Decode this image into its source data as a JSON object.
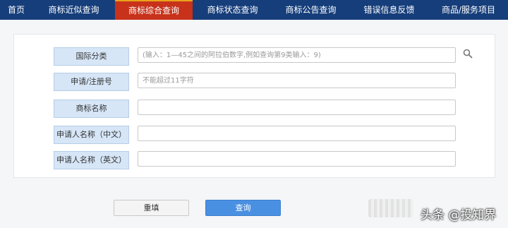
{
  "nav": {
    "items": [
      {
        "label": "首页"
      },
      {
        "label": "商标近似查询"
      },
      {
        "label": "商标综合查询"
      },
      {
        "label": "商标状态查询"
      },
      {
        "label": "商标公告查询"
      },
      {
        "label": "错误信息反馈"
      },
      {
        "label": "商品/服务项目"
      }
    ],
    "active_label": "商标综合查询"
  },
  "form": {
    "fields": [
      {
        "label": "国际分类",
        "value": "",
        "placeholder": "(输入：1—45之间的阿拉伯数字,例如查询第9类输入：9)"
      },
      {
        "label": "申请/注册号",
        "value": "",
        "placeholder": "不能超过11字符"
      },
      {
        "label": "商标名称",
        "value": "",
        "placeholder": ""
      },
      {
        "label": "申请人名称（中文）",
        "value": "",
        "placeholder": ""
      },
      {
        "label": "申请人名称（英文）",
        "value": "",
        "placeholder": ""
      }
    ],
    "search_icon": "search-icon"
  },
  "buttons": {
    "reset_label": "重填",
    "search_label": "查询"
  },
  "watermark": {
    "text": "头条 @投知界"
  },
  "colors": {
    "nav_bg": "#163e7b",
    "nav_active": "#c8321a",
    "label_bg": "#d6e6f7",
    "primary_button": "#4a90e2"
  }
}
